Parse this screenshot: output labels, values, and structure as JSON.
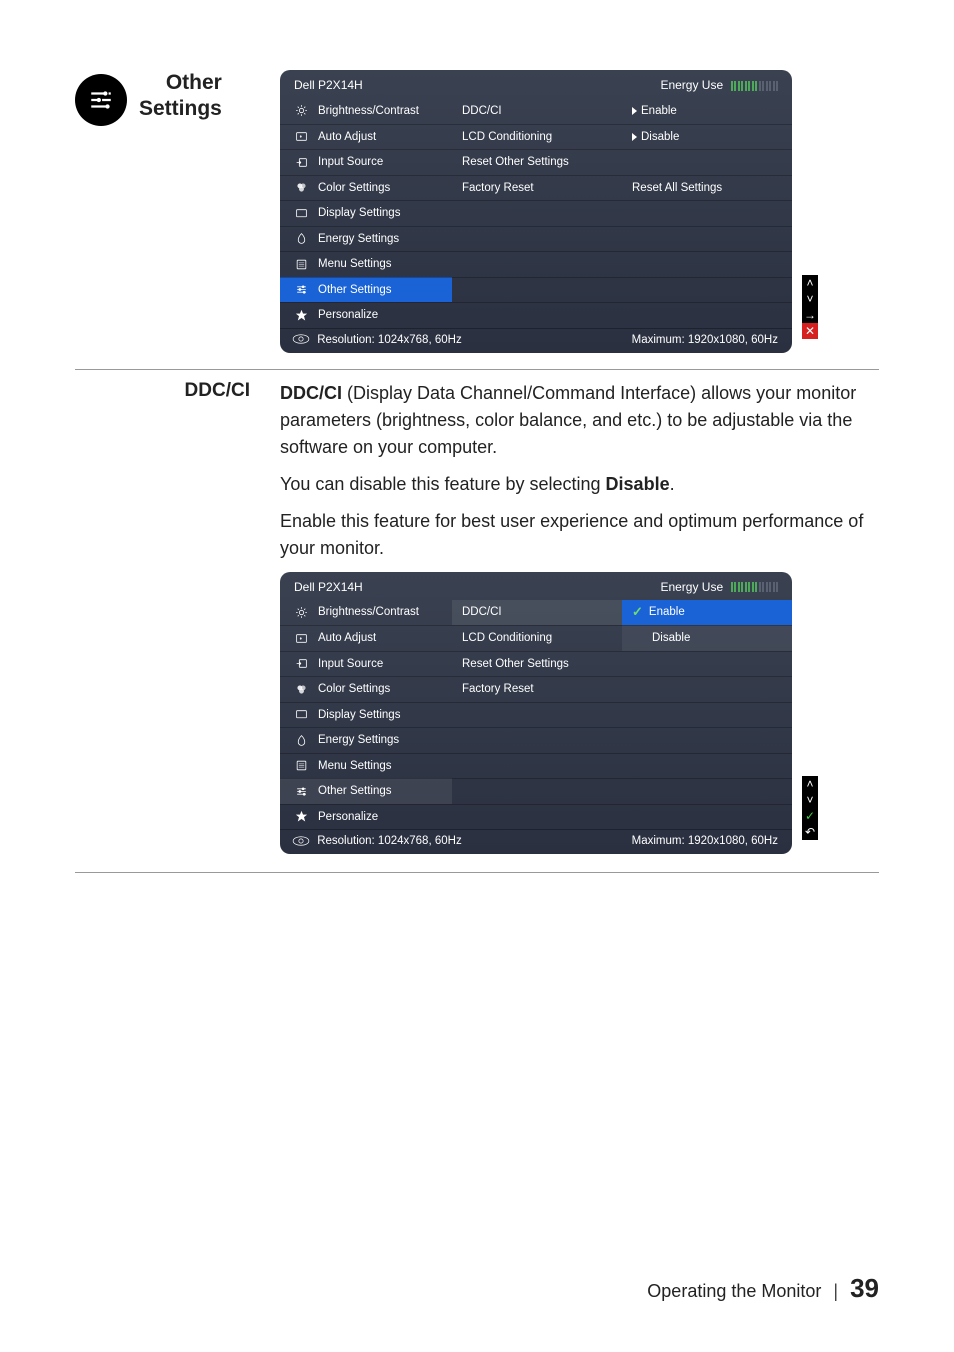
{
  "sections": {
    "other_settings": {
      "title_line1": "Other",
      "title_line2": "Settings"
    },
    "ddcci": {
      "title": "DDC/CI",
      "p1_prefix": "DDC/CI",
      "p1_rest": " (Display Data Channel/Command Interface) allows your monitor parameters (brightness, color balance, and etc.) to be adjustable via the software on your computer.",
      "p2_a": "You can disable this feature by selecting ",
      "p2_b": "Disable",
      "p2_c": ".",
      "p3": "Enable this feature for best user experience and optimum performance of your monitor."
    }
  },
  "osd_common": {
    "model": "Dell P2X14H",
    "energy_label": "Energy Use",
    "menu": [
      {
        "label": "Brightness/Contrast",
        "icon": "brightness"
      },
      {
        "label": "Auto Adjust",
        "icon": "auto"
      },
      {
        "label": "Input Source",
        "icon": "input"
      },
      {
        "label": "Color Settings",
        "icon": "color"
      },
      {
        "label": "Display Settings",
        "icon": "display"
      },
      {
        "label": "Energy Settings",
        "icon": "energy"
      },
      {
        "label": "Menu Settings",
        "icon": "menu"
      },
      {
        "label": "Other Settings",
        "icon": "sliders"
      },
      {
        "label": "Personalize",
        "icon": "star"
      }
    ],
    "resolution": "Resolution: 1024x768, 60Hz",
    "maximum": "Maximum: 1920x1080, 60Hz"
  },
  "osd1": {
    "col2": [
      "DDC/CI",
      "LCD Conditioning",
      "Reset Other Settings",
      "Factory Reset"
    ],
    "col3_r0": {
      "text": "Enable",
      "tri": true
    },
    "col3_r1": {
      "text": "Disable",
      "tri": true
    },
    "col3_r3": {
      "text": "Reset All Settings"
    },
    "side": [
      "up",
      "down",
      "right",
      "close"
    ]
  },
  "osd2": {
    "col2": [
      "DDC/CI",
      "LCD Conditioning",
      "Reset Other Settings",
      "Factory Reset"
    ],
    "opts": [
      {
        "text": "Enable",
        "active": true
      },
      {
        "text": "Disable",
        "active": false
      }
    ],
    "side": [
      "up",
      "down",
      "ok",
      "back"
    ]
  },
  "footer": {
    "text": "Operating the Monitor",
    "page": "39"
  }
}
